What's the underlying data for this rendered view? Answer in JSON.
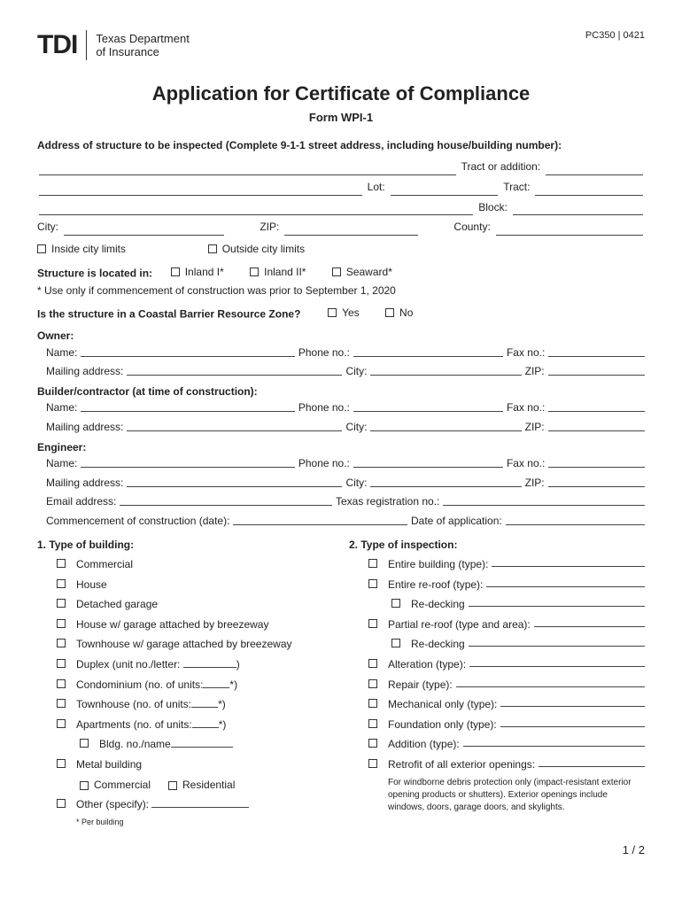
{
  "header": {
    "logo_mark": "TDI",
    "logo_text_1": "Texas Department",
    "logo_text_2": "of Insurance",
    "form_code": "PC350 | 0421"
  },
  "title": "Application for Certificate of Compliance",
  "subtitle": "Form WPI-1",
  "addr_prompt": "Address of structure to be inspected (Complete 9-1-1 street address, including house/building number):",
  "addr_labels": {
    "tract_or_addition": "Tract or addition:",
    "lot": "Lot:",
    "tract": "Tract:",
    "block": "Block:",
    "city": "City:",
    "zip": "ZIP:",
    "county": "County:"
  },
  "limits": {
    "inside": "Inside city limits",
    "outside": "Outside city limits"
  },
  "located": {
    "label": "Structure is located in:",
    "opt1": "Inland I*",
    "opt2": "Inland II*",
    "opt3": "Seaward*",
    "note": "* Use only if commencement of construction was prior to September 1, 2020"
  },
  "coastal": {
    "q": "Is the structure in a Coastal Barrier Resource Zone?",
    "yes": "Yes",
    "no": "No"
  },
  "owner": {
    "heading": "Owner:",
    "name": "Name:",
    "phone": "Phone no.:",
    "fax": "Fax no.:",
    "mailing": "Mailing address:",
    "city": "City:",
    "zip": "ZIP:"
  },
  "builder": {
    "heading": "Builder/contractor (at time of construction):",
    "name": "Name:",
    "phone": "Phone no.:",
    "fax": "Fax no.:",
    "mailing": "Mailing address:",
    "city": "City:",
    "zip": "ZIP:"
  },
  "engineer": {
    "heading": "Engineer:",
    "name": "Name:",
    "phone": "Phone no.:",
    "fax": "Fax no.:",
    "mailing": "Mailing address:",
    "city": "City:",
    "zip": "ZIP:",
    "email": "Email address:",
    "txreg": "Texas registration no.:",
    "commence": "Commencement of construction (date):",
    "appdate": "Date of application:"
  },
  "q1": {
    "heading": "1.  Type of building:",
    "items": {
      "commercial": "Commercial",
      "house": "House",
      "detached": "Detached garage",
      "house_breezeway": "House w/ garage attached by breezeway",
      "townhouse_breezeway": "Townhouse w/ garage attached by breezeway",
      "duplex_pre": "Duplex (unit no./letter:",
      "duplex_post": ")",
      "condo_pre": "Condominium   (no. of units:",
      "condo_post": "*)",
      "townhouse_pre": "Townhouse     (no. of units:",
      "townhouse_post": "*)",
      "apartments_pre": "Apartments     (no. of units:",
      "apartments_post": "*)",
      "bldg_no": "Bldg. no./name",
      "metal": "Metal building",
      "metal_comm": "Commercial",
      "metal_res": "Residential",
      "other": "Other (specify):",
      "per_building": "* Per building"
    }
  },
  "q2": {
    "heading": "2.  Type of inspection:",
    "items": {
      "entire_building": "Entire building (type):",
      "entire_reroof": "Entire re-roof (type):",
      "redecking1": "Re-decking",
      "partial_reroof": "Partial re-roof (type and area):",
      "redecking2": "Re-decking",
      "alteration": "Alteration (type):",
      "repair": "Repair (type):",
      "mechanical": "Mechanical only (type):",
      "foundation": "Foundation only (type):",
      "addition": "Addition (type):",
      "retrofit": "Retrofit of all exterior openings:",
      "note": "For windborne debris protection only (impact-resistant exterior opening products or shutters). Exterior openings include windows, doors, garage doors, and skylights."
    }
  },
  "pager": "1 / 2"
}
